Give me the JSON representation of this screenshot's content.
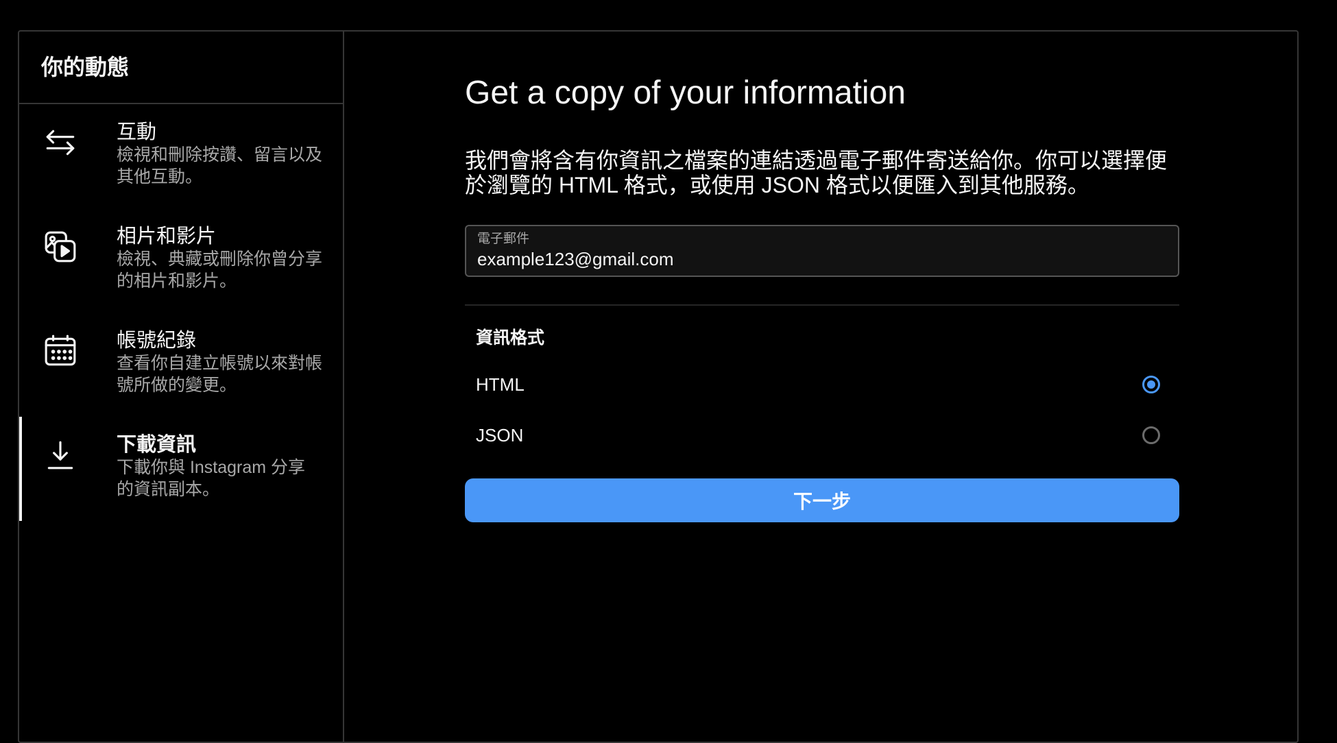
{
  "sidebar": {
    "title": "你的動態",
    "items": [
      {
        "label": "互動",
        "description": "檢視和刪除按讚、留言以及其他互動。",
        "icon": "arrows-swap-icon",
        "active": false
      },
      {
        "label": "相片和影片",
        "description": "檢視、典藏或刪除你曾分享的相片和影片。",
        "icon": "photo-video-icon",
        "active": false
      },
      {
        "label": "帳號紀錄",
        "description": "查看你自建立帳號以來對帳號所做的變更。",
        "icon": "calendar-icon",
        "active": false
      },
      {
        "label": "下載資訊",
        "description": "下載你與 Instagram 分享的資訊副本。",
        "icon": "download-icon",
        "active": true
      }
    ]
  },
  "main": {
    "title": "Get a copy of your information",
    "description": "我們會將含有你資訊之檔案的連結透過電子郵件寄送給你。你可以選擇便於瀏覽的 HTML 格式，或使用 JSON 格式以便匯入到其他服務。",
    "email": {
      "label": "電子郵件",
      "value": "example123@gmail.com"
    },
    "format": {
      "heading": "資訊格式",
      "options": [
        {
          "label": "HTML",
          "selected": true
        },
        {
          "label": "JSON",
          "selected": false
        }
      ]
    },
    "next_button": "下一步"
  },
  "colors": {
    "background": "#000000",
    "border": "#363636",
    "accent": "#4a97f7",
    "text_primary": "#f5f5f5",
    "text_secondary": "#a8a8a8"
  }
}
